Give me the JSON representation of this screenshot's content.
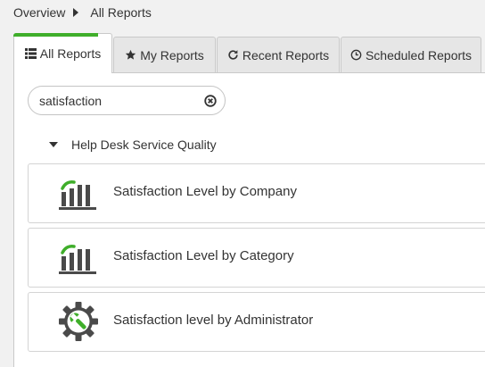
{
  "breadcrumb": {
    "items": [
      "Overview",
      "All Reports"
    ]
  },
  "tabs": [
    {
      "label": "All Reports",
      "icon": "list-icon",
      "active": true
    },
    {
      "label": "My Reports",
      "icon": "star-icon",
      "active": false
    },
    {
      "label": "Recent Reports",
      "icon": "refresh-icon",
      "active": false
    },
    {
      "label": "Scheduled Reports",
      "icon": "clock-icon",
      "active": false
    }
  ],
  "search": {
    "value": "satisfaction"
  },
  "group": {
    "label": "Help Desk Service Quality"
  },
  "reports": [
    {
      "label": "Satisfaction Level by Company",
      "icon": "satisfaction-chart-icon"
    },
    {
      "label": "Satisfaction Level by Category",
      "icon": "satisfaction-chart-icon"
    },
    {
      "label": "Satisfaction level by Administrator",
      "icon": "gear-wrench-icon"
    }
  ],
  "colors": {
    "accent": "#3fae2a",
    "icon_dark": "#4a4a4a"
  }
}
